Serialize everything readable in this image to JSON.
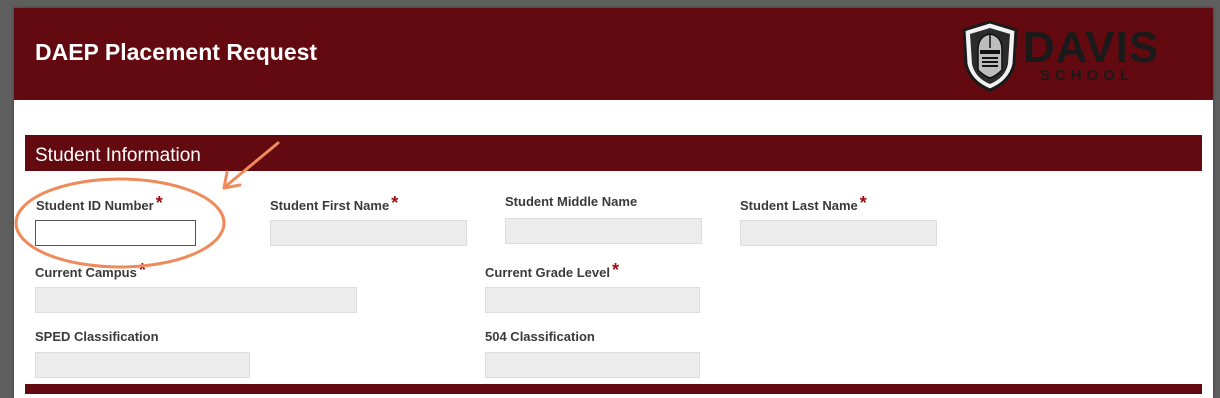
{
  "page": {
    "title": "DAEP Placement Request"
  },
  "logo": {
    "name": "DAVIS",
    "subtitle": "SCHOOL"
  },
  "section": {
    "title": "Student Information"
  },
  "fields": {
    "student_id": {
      "label": "Student ID Number",
      "required": "*",
      "value": ""
    },
    "first_name": {
      "label": "Student First Name",
      "required": "*",
      "value": ""
    },
    "middle_name": {
      "label": "Student Middle Name",
      "value": ""
    },
    "last_name": {
      "label": "Student Last Name",
      "required": "*",
      "value": ""
    },
    "current_campus": {
      "label": "Current Campus",
      "required": "*",
      "value": ""
    },
    "grade_level": {
      "label": "Current Grade Level",
      "required": "*",
      "value": ""
    },
    "sped": {
      "label": "SPED Classification",
      "value": ""
    },
    "c504": {
      "label": "504 Classification",
      "value": ""
    }
  },
  "colors": {
    "brand": "#630a10",
    "required": "#9b0d12",
    "annotation": "#ef8a5a",
    "page_bg": "#5e5e5e"
  },
  "icons": [
    "knight-helmet-icon"
  ]
}
